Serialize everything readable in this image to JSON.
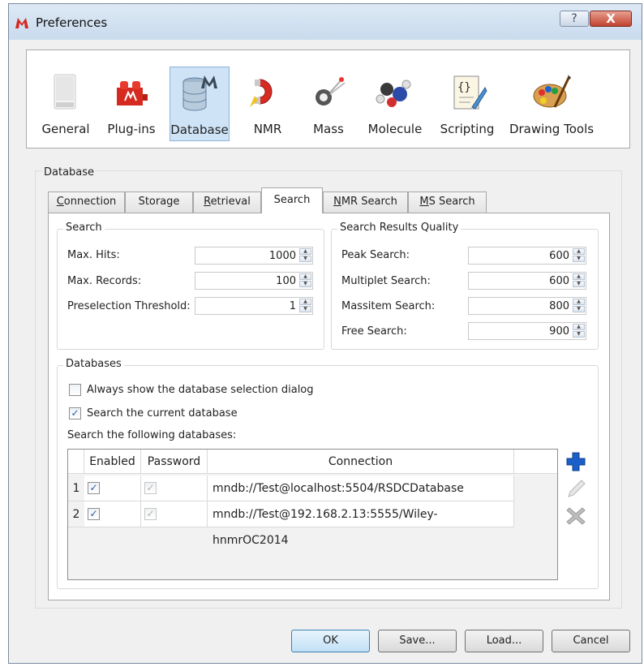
{
  "window": {
    "title": "Preferences",
    "help_label": "?",
    "close_label": "X"
  },
  "nav": {
    "items": [
      {
        "label": "General",
        "icon": "general-icon"
      },
      {
        "label": "Plug-ins",
        "icon": "plugins-icon"
      },
      {
        "label": "Database",
        "icon": "database-icon",
        "selected": true
      },
      {
        "label": "NMR",
        "icon": "nmr-icon"
      },
      {
        "label": "Mass",
        "icon": "mass-icon"
      },
      {
        "label": "Molecule",
        "icon": "molecule-icon"
      },
      {
        "label": "Scripting",
        "icon": "scripting-icon"
      },
      {
        "label": "Drawing Tools",
        "icon": "drawing-tools-icon"
      }
    ]
  },
  "database_group": {
    "label": "Database",
    "tabs": [
      {
        "label": "Connection",
        "mnemonic": "C",
        "rest": "onnection"
      },
      {
        "label": "Storage",
        "mnemonic": "",
        "rest": "Storage"
      },
      {
        "label": "Retrieval",
        "mnemonic": "R",
        "rest": "etrieval"
      },
      {
        "label": "Search",
        "mnemonic": "",
        "rest": "Search",
        "active": true
      },
      {
        "label": "NMR Search",
        "mnemonic": "N",
        "rest": "MR Search"
      },
      {
        "label": "MS Search",
        "mnemonic": "M",
        "rest": "S Search"
      }
    ],
    "search": {
      "label": "Search",
      "fields": [
        {
          "label": "Max. Hits:",
          "value": "1000"
        },
        {
          "label": "Max. Records:",
          "value": "100"
        },
        {
          "label": "Preselection Threshold:",
          "value": "1"
        }
      ]
    },
    "quality": {
      "label": "Search Results Quality",
      "fields": [
        {
          "label": "Peak Search:",
          "value": "600"
        },
        {
          "label": "Multiplet Search:",
          "value": "600"
        },
        {
          "label": "Massitem Search:",
          "value": "800"
        },
        {
          "label": "Free Search:",
          "value": "900"
        }
      ]
    },
    "databases": {
      "label": "Databases",
      "always_show": {
        "label": "Always show the database selection dialog",
        "checked": false
      },
      "search_current": {
        "label": "Search the current database",
        "checked": true
      },
      "following_label": "Search the following databases:",
      "table": {
        "headers": [
          "Enabled",
          "Password",
          "Connection"
        ],
        "rows": [
          {
            "num": "1",
            "enabled": true,
            "password": true,
            "connection": "mndb://Test@localhost:5504/RSDCDatabase"
          },
          {
            "num": "2",
            "enabled": true,
            "password": true,
            "connection": "mndb://Test@192.168.2.13:5555/Wiley-hnmrOC2014"
          }
        ]
      }
    }
  },
  "buttons": {
    "ok": "OK",
    "save": "Save...",
    "load": "Load...",
    "cancel": "Cancel"
  },
  "colors": {
    "selection": "#cfe3f7",
    "check": "#2b5aa8",
    "add_button": "#1a5fc8"
  }
}
